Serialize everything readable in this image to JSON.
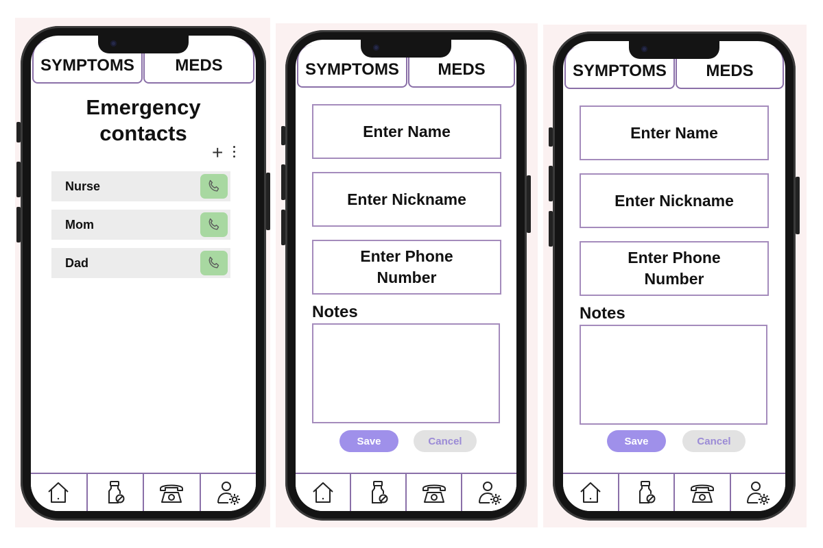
{
  "tabs": {
    "symptoms": "SYMPTOMS",
    "meds": "MEDS"
  },
  "screen1": {
    "title_line1": "Emergency",
    "title_line2": "contacts",
    "add_symbol": "+",
    "contacts": [
      {
        "name": "Nurse"
      },
      {
        "name": "Mom"
      },
      {
        "name": "Dad"
      }
    ]
  },
  "form": {
    "name_placeholder": "Enter Name",
    "nickname_placeholder": "Enter Nickname",
    "phone_line1": "Enter Phone",
    "phone_line2": "Number",
    "notes_label": "Notes",
    "save_label": "Save",
    "cancel_label": "Cancel"
  },
  "nav": {
    "icons": [
      "home-icon",
      "medicine-bottle-icon",
      "telephone-icon",
      "user-settings-icon"
    ]
  },
  "colors": {
    "accent_border": "#a48bbc",
    "call_button": "#a8d8a1",
    "save_button": "#9f90ea",
    "cancel_button": "#e2e2e2",
    "contact_row": "#ececec"
  }
}
